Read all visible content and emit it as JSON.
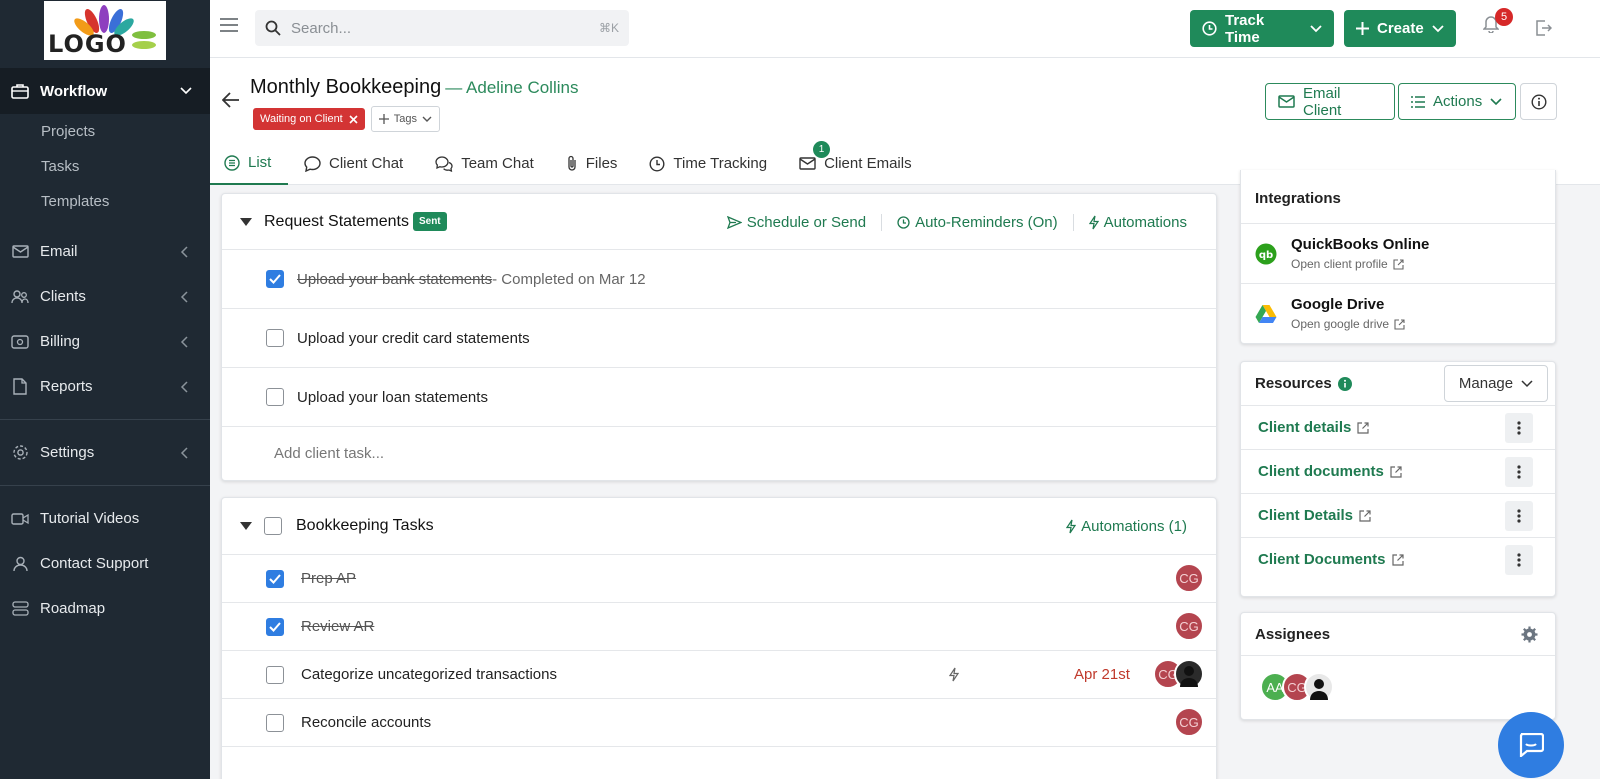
{
  "logo": {
    "text": "LOGO"
  },
  "sidebar": {
    "workflow": {
      "label": "Workflow",
      "children": [
        "Projects",
        "Tasks",
        "Templates"
      ]
    },
    "items": [
      {
        "label": "Email",
        "icon": "mail-icon"
      },
      {
        "label": "Clients",
        "icon": "users-icon"
      },
      {
        "label": "Billing",
        "icon": "billing-icon"
      },
      {
        "label": "Reports",
        "icon": "file-icon"
      }
    ],
    "settings": {
      "label": "Settings"
    },
    "bottom": [
      {
        "label": "Tutorial Videos"
      },
      {
        "label": "Contact Support"
      },
      {
        "label": "Roadmap"
      }
    ]
  },
  "topbar": {
    "search_placeholder": "Search...",
    "search_shortcut": "⌘K",
    "track_time": "Track Time",
    "create": "Create",
    "notification_count": "5"
  },
  "header": {
    "title": "Monthly Bookkeeping",
    "client": "— Adeline Collins",
    "status": "Waiting on Client",
    "tags_label": "Tags",
    "email_client": "Email Client",
    "actions": "Actions",
    "tabs": [
      {
        "label": "List"
      },
      {
        "label": "Client Chat"
      },
      {
        "label": "Team Chat"
      },
      {
        "label": "Files"
      },
      {
        "label": "Time Tracking"
      },
      {
        "label": "Client Emails",
        "count": "1"
      }
    ]
  },
  "request": {
    "title": "Request Statements",
    "badge": "Sent",
    "actions": [
      "Schedule or Send",
      "Auto-Reminders (On)",
      "Automations"
    ],
    "rows": [
      {
        "text": "Upload your bank statements",
        "suffix": " - Completed on Mar 12",
        "checked": true
      },
      {
        "text": "Upload your credit card statements",
        "checked": false
      },
      {
        "text": "Upload your loan statements",
        "checked": false
      }
    ],
    "add_placeholder": "Add client task..."
  },
  "bookkeeping": {
    "title": "Bookkeeping Tasks",
    "automations": "Automations (1)",
    "rows": [
      {
        "text": "Prep AP",
        "checked": true,
        "assignee": "CG"
      },
      {
        "text": "Review AR",
        "checked": true,
        "assignee": "CG"
      },
      {
        "text": "Categorize uncategorized transactions",
        "checked": false,
        "due": "Apr 21st",
        "assignee": "CG"
      },
      {
        "text": "Reconcile accounts",
        "checked": false,
        "assignee": "CG"
      }
    ]
  },
  "integrations": {
    "title": "Integrations",
    "items": [
      {
        "name": "QuickBooks Online",
        "sub": "Open client profile"
      },
      {
        "name": "Google Drive",
        "sub": "Open google drive"
      }
    ]
  },
  "resources": {
    "title": "Resources",
    "manage": "Manage",
    "items": [
      "Client details",
      "Client documents",
      "Client Details",
      "Client Documents"
    ]
  },
  "assignees": {
    "title": "Assignees",
    "people": [
      "AA",
      "CG"
    ]
  },
  "colors": {
    "accent": "#1f8a5a",
    "sidebar": "#1f2933",
    "danger": "#d33434",
    "checkbox": "#2f7de1"
  }
}
